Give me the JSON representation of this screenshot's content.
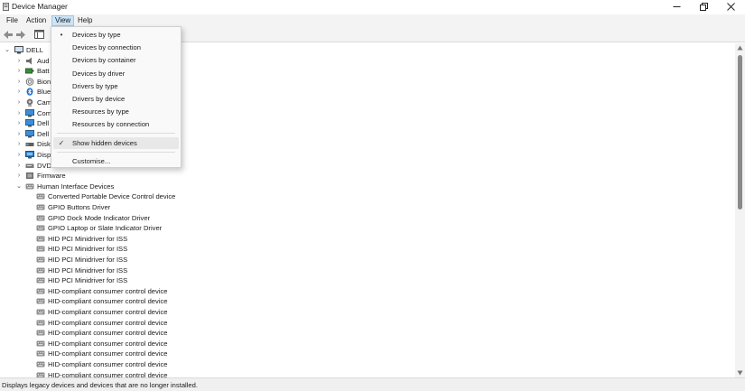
{
  "window": {
    "title": "Device Manager",
    "minimize_glyph": "—",
    "maximize_glyph": "❐",
    "close_glyph": "✕"
  },
  "menubar": {
    "items": [
      {
        "label": "File"
      },
      {
        "label": "Action"
      },
      {
        "label": "View"
      },
      {
        "label": "Help"
      }
    ]
  },
  "view_menu": {
    "items": [
      {
        "label": "Devices by type",
        "mark": "•"
      },
      {
        "label": "Devices by connection",
        "mark": ""
      },
      {
        "label": "Devices by container",
        "mark": ""
      },
      {
        "label": "Devices by driver",
        "mark": ""
      },
      {
        "label": "Drivers by type",
        "mark": ""
      },
      {
        "label": "Drivers by device",
        "mark": ""
      },
      {
        "label": "Resources by type",
        "mark": ""
      },
      {
        "label": "Resources by connection",
        "mark": ""
      },
      {
        "label": "Show hidden devices",
        "mark": "✓"
      },
      {
        "label": "Customise...",
        "mark": ""
      }
    ]
  },
  "tree": {
    "root": {
      "label": "DELL",
      "expander": "⌄"
    },
    "categories": [
      {
        "label": "Aud",
        "expander": "›"
      },
      {
        "label": "Batt",
        "expander": "›"
      },
      {
        "label": "Bion",
        "expander": "›"
      },
      {
        "label": "Blue",
        "expander": "›"
      },
      {
        "label": "Cam",
        "expander": "›"
      },
      {
        "label": "Com",
        "expander": "›"
      },
      {
        "label": "Dell",
        "expander": "›"
      },
      {
        "label": "Dell",
        "expander": "›"
      },
      {
        "label": "Disk",
        "expander": "›"
      },
      {
        "label": "Disp",
        "expander": "›"
      },
      {
        "label": "DVD",
        "expander": "›"
      },
      {
        "label": "Firmware",
        "expander": "›"
      },
      {
        "label": "Human Interface Devices",
        "expander": "⌄"
      }
    ],
    "hid_children": [
      {
        "label": "Converted Portable Device Control device"
      },
      {
        "label": "GPIO Buttons Driver"
      },
      {
        "label": "GPIO Dock Mode Indicator Driver"
      },
      {
        "label": "GPIO Laptop or Slate Indicator Driver"
      },
      {
        "label": "HID PCI Minidriver for ISS"
      },
      {
        "label": "HID PCI Minidriver for ISS"
      },
      {
        "label": "HID PCI Minidriver for ISS"
      },
      {
        "label": "HID PCI Minidriver for ISS"
      },
      {
        "label": "HID PCI Minidriver for ISS"
      },
      {
        "label": "HID-compliant consumer control device"
      },
      {
        "label": "HID-compliant consumer control device"
      },
      {
        "label": "HID-compliant consumer control device"
      },
      {
        "label": "HID-compliant consumer control device"
      },
      {
        "label": "HID-compliant consumer control device"
      },
      {
        "label": "HID-compliant consumer control device"
      },
      {
        "label": "HID-compliant consumer control device"
      },
      {
        "label": "HID-compliant consumer control device"
      },
      {
        "label": "HID-compliant consumer control device"
      }
    ]
  },
  "statusbar": {
    "text": "Displays legacy devices and devices that are no longer installed."
  },
  "icons": {
    "back": "back-arrow-icon",
    "forward": "forward-arrow-icon",
    "properties": "properties-icon",
    "hid_device": "hid-device-icon"
  },
  "colors": {
    "menu_active_bg": "#cce4f7",
    "menu_highlight_bg": "#e8e8e8",
    "scroll_thumb": "#8a8a8a"
  }
}
